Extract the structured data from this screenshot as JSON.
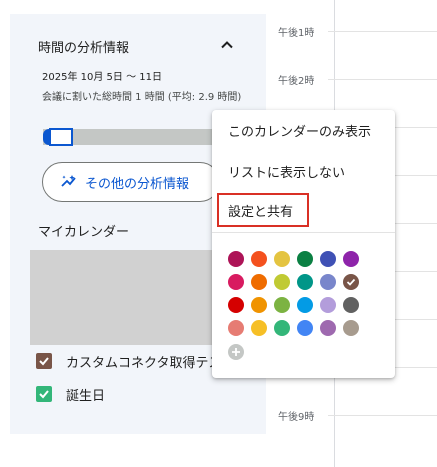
{
  "time_grid": {
    "labels": [
      "午後1時",
      "午後2時",
      "午後9時"
    ]
  },
  "analysis": {
    "title": "時間の分析情報",
    "date_range": "2025年 10月 5日 ～ 11日",
    "meeting_summary": "会議に割いた総時間 1 時間 (平均: 2.9 時間)",
    "meeting_fraction": 0.03,
    "more_button_label": "その他の分析情報"
  },
  "my_calendars": {
    "heading": "マイカレンダー",
    "items": [
      {
        "label": "カスタムコネクタ取得テスト",
        "checked": true,
        "color": "#795548"
      },
      {
        "label": "誕生日",
        "checked": true,
        "color": "#33b679"
      }
    ]
  },
  "context_menu": {
    "items": [
      "このカレンダーのみ表示",
      "リストに表示しない",
      "設定と共有"
    ],
    "highlighted_item": "設定と共有",
    "colors": [
      [
        "#ad1457",
        "#f4511e",
        "#e4c441",
        "#0b8043",
        "#3f51b5",
        "#8e24aa"
      ],
      [
        "#d81b60",
        "#ef6c00",
        "#c0ca33",
        "#009688",
        "#7986cb",
        "#795548"
      ],
      [
        "#d50000",
        "#f09300",
        "#7cb342",
        "#039be5",
        "#b39ddb",
        "#616161"
      ],
      [
        "#e67c73",
        "#f6bf26",
        "#33b679",
        "#4285f4",
        "#9e69af",
        "#a79b8e"
      ]
    ],
    "selected_color": "#795548"
  }
}
